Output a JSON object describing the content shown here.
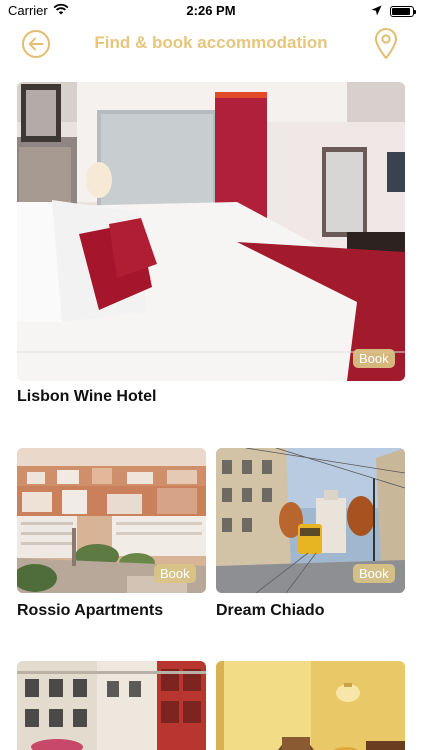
{
  "status_bar": {
    "carrier": "Carrier",
    "time": "2:26 PM",
    "battery_level": 0.9,
    "icons": [
      "wifi-icon",
      "location-arrow-icon",
      "battery-icon"
    ]
  },
  "nav": {
    "title": "Find & book accommodation",
    "back_icon": "back-arrow-icon",
    "map_icon": "map-pin-icon",
    "accent_color": "#e6c57d"
  },
  "listings": [
    {
      "name": "Lisbon Wine Hotel",
      "badge": "Book"
    },
    {
      "name": "Rossio Apartments",
      "badge": "Book"
    },
    {
      "name": "Dream Chiado",
      "badge": "Book"
    },
    {
      "name": "",
      "badge": ""
    },
    {
      "name": "",
      "badge": ""
    }
  ]
}
